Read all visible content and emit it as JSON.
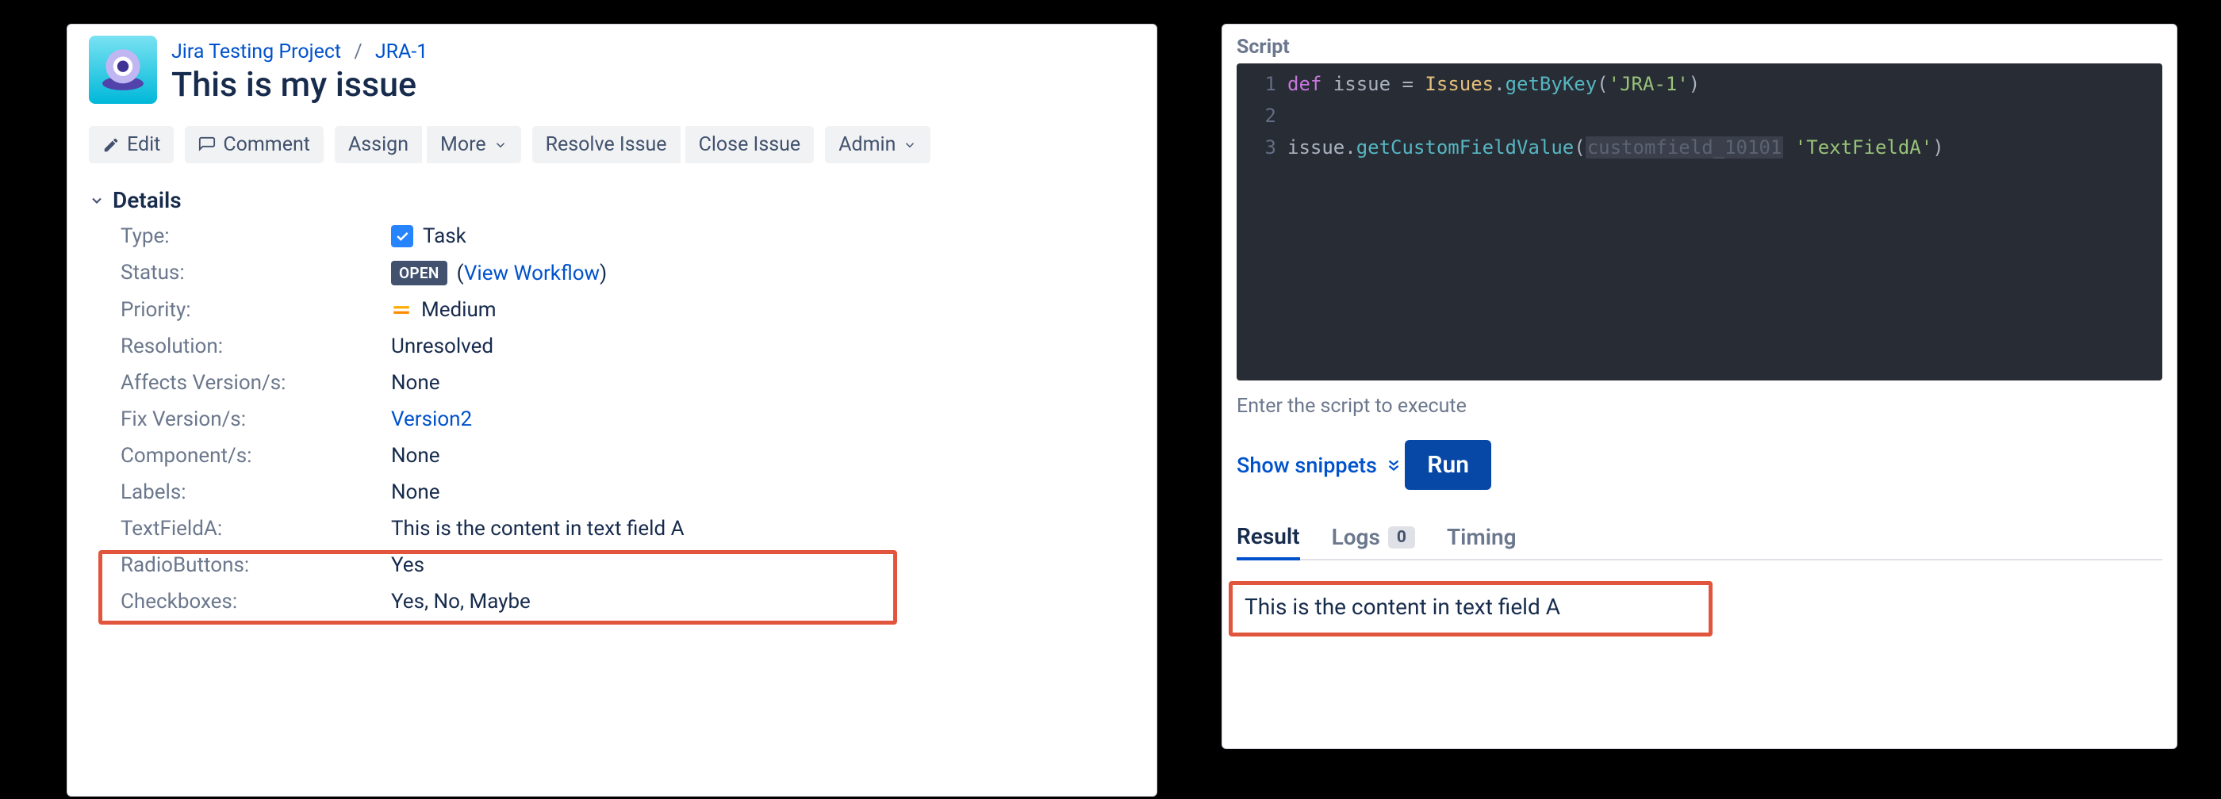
{
  "jira": {
    "breadcrumb": {
      "project": "Jira Testing Project",
      "issue_key": "JRA-1"
    },
    "title": "This is my issue",
    "toolbar": {
      "edit": "Edit",
      "comment": "Comment",
      "assign": "Assign",
      "more": "More",
      "resolve": "Resolve Issue",
      "close": "Close Issue",
      "admin": "Admin"
    },
    "details_header": "Details",
    "fields": {
      "type": {
        "label": "Type:",
        "value": "Task"
      },
      "status": {
        "label": "Status:",
        "badge": "OPEN",
        "link": "View Workflow"
      },
      "priority": {
        "label": "Priority:",
        "value": "Medium"
      },
      "resolution": {
        "label": "Resolution:",
        "value": "Unresolved"
      },
      "affects": {
        "label": "Affects Version/s:",
        "value": "None"
      },
      "fix": {
        "label": "Fix Version/s:",
        "value": "Version2",
        "is_link": true
      },
      "components": {
        "label": "Component/s:",
        "value": "None"
      },
      "labels": {
        "label": "Labels:",
        "value": "None"
      },
      "textfielda": {
        "label": "TextFieldA:",
        "value": "This is the content in text field A"
      },
      "radiobuttons": {
        "label": "RadioButtons:",
        "value": "Yes"
      },
      "checkboxes": {
        "label": "Checkboxes:",
        "value": "Yes, No, Maybe"
      }
    }
  },
  "script": {
    "label": "Script",
    "code": {
      "line1": {
        "kw": "def",
        "ident": " issue ",
        "op": "= ",
        "cls": "Issues",
        "dot": ".",
        "method": "getByKey",
        "lp": "(",
        "str": "'JRA-1'",
        "rp": ")"
      },
      "line3": {
        "ident": "issue",
        "dot": ".",
        "method": "getCustomFieldValue",
        "lp": "(",
        "dim": "customfield_10101",
        "sp": " ",
        "str": "'TextFieldA'",
        "rp": ")"
      }
    },
    "hint": "Enter the script to execute",
    "snippets": "Show snippets",
    "run": "Run",
    "tabs": {
      "result": "Result",
      "logs": "Logs",
      "logs_count": "0",
      "timing": "Timing"
    },
    "result_value": "This is the content in text field A"
  }
}
